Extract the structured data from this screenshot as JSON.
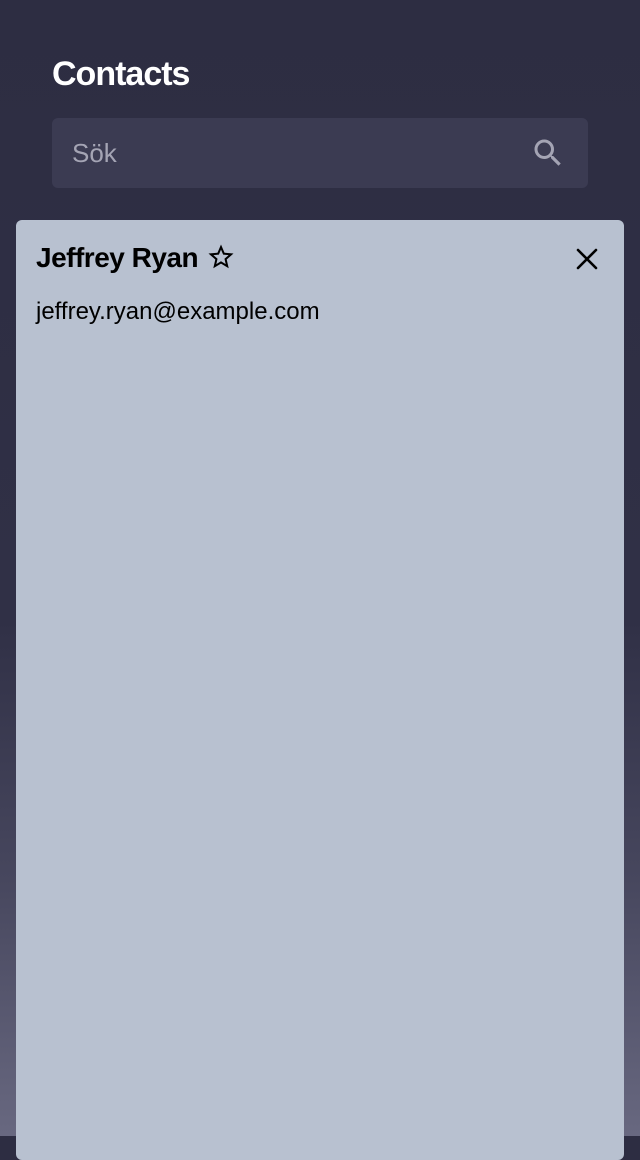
{
  "header": {
    "title": "Contacts"
  },
  "search": {
    "placeholder": "Sök",
    "value": "",
    "icon": "search-icon"
  },
  "contact_card": {
    "name": "Jeffrey Ryan",
    "email": "jeffrey.ryan@example.com",
    "favorite_icon": "star-outline-icon",
    "close_icon": "close-icon"
  },
  "colors": {
    "background": "#2d2d42",
    "search_bg": "#3b3b52",
    "card_bg": "#b8c1d0",
    "title_text": "#ffffff",
    "card_text": "#000000"
  }
}
